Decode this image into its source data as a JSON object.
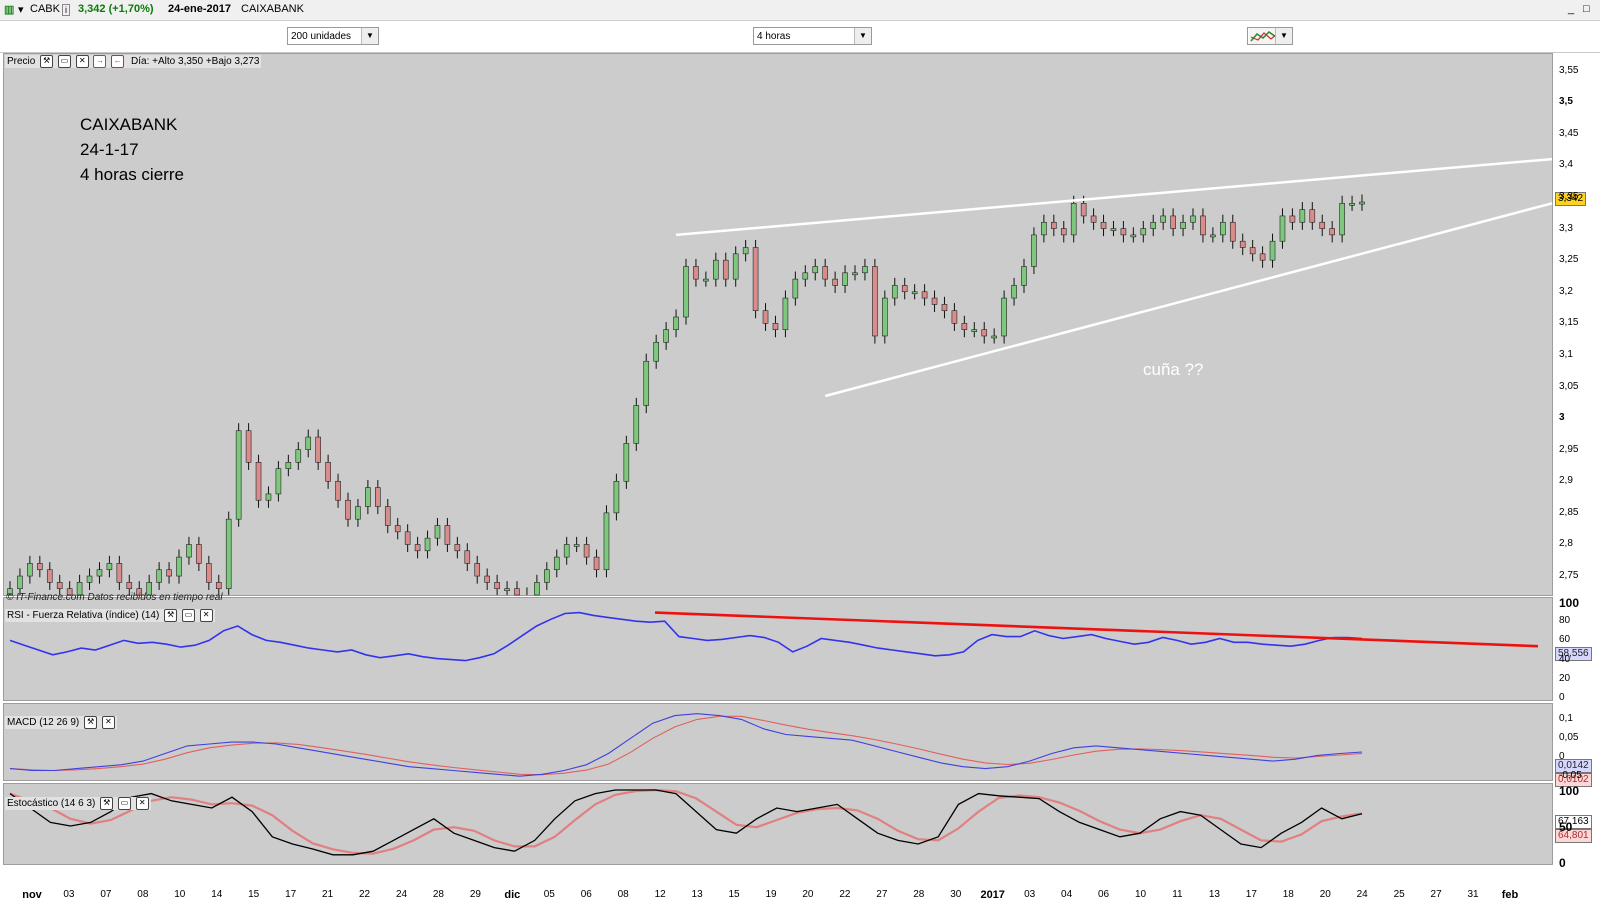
{
  "header": {
    "ticker": "CABK",
    "info_icon": "i",
    "price_change": "3,342 (+1,70%)",
    "date": "24-ene-2017",
    "name": "CAIXABANK",
    "window_controls": [
      "_",
      "□"
    ]
  },
  "toolbar": {
    "units_select": "200 unidades",
    "interval_select": "4 horas",
    "chart_type_icon": "candlestick-chart-icon"
  },
  "price_panel": {
    "label": "Precio",
    "day_info": "Día: +Alto 3,350 +Bajo 3,273",
    "footer": "© IT-Finance.com  Datos recibidos en tiempo real",
    "annotation_lines": [
      "CAIXABANK",
      "24-1-17",
      "4 horas cierre"
    ],
    "wedge_note": "cuña ??",
    "last_price": "3,342",
    "y_ticks": [
      "3,55",
      "3,5",
      "3,45",
      "3,4",
      "3,35",
      "3,3",
      "3,25",
      "3,2",
      "3,15",
      "3,1",
      "3,05",
      "3",
      "2,95",
      "2,9",
      "2,85",
      "2,8",
      "2,75"
    ]
  },
  "rsi_panel": {
    "label": "RSI - Fuerza Relativa (índice) (14)",
    "y_ticks": [
      "100",
      "80",
      "60",
      "40",
      "20",
      "0"
    ],
    "last_value": "58,556"
  },
  "macd_panel": {
    "label": "MACD (12 26 9)",
    "y_ticks": [
      "0,1",
      "0,05",
      "0",
      "-0,05"
    ],
    "macd_value": "0,0142",
    "signal_value": "0,0102"
  },
  "stoch_panel": {
    "label": "Estocástico (14 6 3)",
    "y_ticks": [
      "100",
      "50",
      "0"
    ],
    "k_value": "67,163",
    "d_value": "64,801"
  },
  "x_axis_labels": [
    {
      "t": "nov",
      "bold": true
    },
    {
      "t": "03"
    },
    {
      "t": "07"
    },
    {
      "t": "08"
    },
    {
      "t": "10"
    },
    {
      "t": "14"
    },
    {
      "t": "15"
    },
    {
      "t": "17"
    },
    {
      "t": "21"
    },
    {
      "t": "22"
    },
    {
      "t": "24"
    },
    {
      "t": "28"
    },
    {
      "t": "29"
    },
    {
      "t": "dic",
      "bold": true
    },
    {
      "t": "05"
    },
    {
      "t": "06"
    },
    {
      "t": "08"
    },
    {
      "t": "12"
    },
    {
      "t": "13"
    },
    {
      "t": "15"
    },
    {
      "t": "19"
    },
    {
      "t": "20"
    },
    {
      "t": "22"
    },
    {
      "t": "27"
    },
    {
      "t": "28"
    },
    {
      "t": "30"
    },
    {
      "t": "2017",
      "bold": true
    },
    {
      "t": "03"
    },
    {
      "t": "04"
    },
    {
      "t": "06"
    },
    {
      "t": "10"
    },
    {
      "t": "11"
    },
    {
      "t": "13"
    },
    {
      "t": "17"
    },
    {
      "t": "18"
    },
    {
      "t": "20"
    },
    {
      "t": "24"
    },
    {
      "t": "25"
    },
    {
      "t": "27"
    },
    {
      "t": "31"
    },
    {
      "t": "feb",
      "bold": true
    }
  ],
  "colors": {
    "up_candle": "#7ec87e",
    "down_candle": "#d98c8c",
    "rsi_line": "#3333ee",
    "rsi_trend": "#ee1111",
    "macd_line": "#4040dd",
    "signal_line": "#e06060",
    "stoch_k": "#000000",
    "stoch_d": "#e08080",
    "trendlines": "#ffffff",
    "panel_bg": "#cccccc"
  },
  "chart_data": {
    "type": "candlestick",
    "ylim": [
      2.72,
      3.57
    ],
    "series": [
      {
        "name": "Precio",
        "values": [
          2.73,
          2.75,
          2.77,
          2.76,
          2.74,
          2.73,
          2.72,
          2.74,
          2.75,
          2.76,
          2.77,
          2.74,
          2.73,
          2.72,
          2.74,
          2.76,
          2.75,
          2.78,
          2.8,
          2.77,
          2.74,
          2.73,
          2.84,
          2.98,
          2.93,
          2.87,
          2.88,
          2.92,
          2.93,
          2.95,
          2.97,
          2.93,
          2.9,
          2.87,
          2.84,
          2.86,
          2.89,
          2.86,
          2.83,
          2.82,
          2.8,
          2.79,
          2.81,
          2.83,
          2.8,
          2.79,
          2.77,
          2.75,
          2.74,
          2.73,
          2.73,
          2.72,
          2.72,
          2.74,
          2.76,
          2.78,
          2.8,
          2.8,
          2.78,
          2.76,
          2.85,
          2.9,
          2.96,
          3.02,
          3.09,
          3.12,
          3.14,
          3.16,
          3.24,
          3.22,
          3.22,
          3.25,
          3.22,
          3.26,
          3.27,
          3.17,
          3.15,
          3.14,
          3.19,
          3.22,
          3.23,
          3.24,
          3.22,
          3.21,
          3.23,
          3.23,
          3.24,
          3.13,
          3.19,
          3.21,
          3.2,
          3.2,
          3.19,
          3.18,
          3.17,
          3.15,
          3.14,
          3.14,
          3.13,
          3.13,
          3.19,
          3.21,
          3.24,
          3.29,
          3.31,
          3.3,
          3.29,
          3.34,
          3.32,
          3.31,
          3.3,
          3.3,
          3.29,
          3.29,
          3.3,
          3.31,
          3.32,
          3.3,
          3.31,
          3.32,
          3.29,
          3.29,
          3.31,
          3.28,
          3.27,
          3.26,
          3.25,
          3.28,
          3.32,
          3.31,
          3.33,
          3.31,
          3.3,
          3.29,
          3.34,
          3.34,
          3.342
        ]
      },
      {
        "name": "RSI",
        "values": [
          60,
          55,
          50,
          45,
          48,
          52,
          50,
          55,
          60,
          57,
          58,
          56,
          53,
          55,
          60,
          70,
          75,
          66,
          60,
          58,
          55,
          52,
          50,
          48,
          50,
          45,
          42,
          44,
          46,
          43,
          41,
          40,
          39,
          42,
          46,
          55,
          65,
          75,
          82,
          88,
          89,
          86,
          84,
          82,
          80,
          79,
          80,
          64,
          62,
          60,
          61,
          63,
          65,
          63,
          58,
          48,
          54,
          62,
          60,
          58,
          55,
          52,
          50,
          48,
          46,
          44,
          45,
          48,
          60,
          66,
          64,
          64,
          70,
          65,
          62,
          64,
          66,
          62,
          59,
          56,
          58,
          63,
          60,
          56,
          58,
          62,
          58,
          58,
          56,
          55,
          54,
          56,
          60,
          63,
          63,
          62
        ]
      },
      {
        "name": "MACD",
        "values": [
          -0.03,
          -0.035,
          -0.035,
          -0.03,
          -0.025,
          -0.02,
          -0.01,
          0.01,
          0.03,
          0.035,
          0.04,
          0.04,
          0.035,
          0.025,
          0.015,
          0.005,
          -0.005,
          -0.015,
          -0.025,
          -0.03,
          -0.035,
          -0.04,
          -0.045,
          -0.05,
          -0.045,
          -0.035,
          -0.02,
          0.01,
          0.05,
          0.09,
          0.11,
          0.115,
          0.11,
          0.1,
          0.075,
          0.06,
          0.055,
          0.05,
          0.045,
          0.03,
          0.015,
          0.0,
          -0.015,
          -0.025,
          -0.03,
          -0.025,
          -0.01,
          0.01,
          0.025,
          0.03,
          0.025,
          0.02,
          0.015,
          0.01,
          0.005,
          0.0,
          -0.005,
          -0.01,
          -0.005,
          0.005,
          0.01,
          0.014
        ]
      },
      {
        "name": "Señal",
        "values": [
          -0.03,
          -0.033,
          -0.035,
          -0.033,
          -0.03,
          -0.025,
          -0.018,
          -0.005,
          0.012,
          0.025,
          0.032,
          0.037,
          0.038,
          0.034,
          0.026,
          0.017,
          0.008,
          -0.002,
          -0.012,
          -0.02,
          -0.027,
          -0.033,
          -0.039,
          -0.045,
          -0.046,
          -0.042,
          -0.034,
          -0.018,
          0.013,
          0.05,
          0.08,
          0.1,
          0.108,
          0.108,
          0.097,
          0.085,
          0.074,
          0.065,
          0.057,
          0.047,
          0.035,
          0.022,
          0.008,
          -0.005,
          -0.015,
          -0.019,
          -0.016,
          -0.006,
          0.006,
          0.016,
          0.021,
          0.022,
          0.02,
          0.017,
          0.013,
          0.009,
          0.005,
          0.0,
          -0.002,
          0.002,
          0.006,
          0.0102
        ]
      },
      {
        "name": "Estocástico %K",
        "values": [
          95,
          75,
          55,
          50,
          55,
          70,
          90,
          95,
          85,
          80,
          75,
          90,
          70,
          35,
          25,
          18,
          10,
          10,
          15,
          30,
          45,
          60,
          40,
          30,
          20,
          15,
          30,
          60,
          85,
          95,
          100,
          100,
          100,
          95,
          70,
          45,
          40,
          60,
          75,
          70,
          75,
          80,
          60,
          40,
          30,
          25,
          35,
          80,
          95,
          92,
          90,
          88,
          70,
          55,
          45,
          35,
          40,
          60,
          70,
          65,
          45,
          25,
          20,
          40,
          55,
          75,
          60,
          67
        ]
      }
    ]
  }
}
